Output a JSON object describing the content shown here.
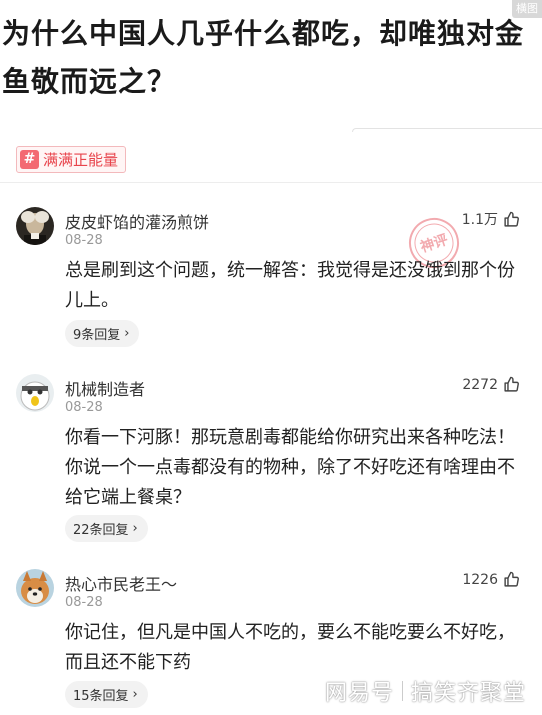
{
  "corner_label": "横图",
  "question": {
    "title": "为什么中国人几乎什么都吃，却唯独对金鱼敬而远之？"
  },
  "topic": {
    "label": "满满正能量",
    "icon": "hash-icon"
  },
  "stamp": {
    "text": "神评"
  },
  "comments": [
    {
      "username": "皮皮虾馅的灌汤煎饼",
      "date": "08-28",
      "likes": "1.1万",
      "text": "总是刷到这个问题，统一解答：我觉得是还没饿到那个份儿上。",
      "replies": "9条回复"
    },
    {
      "username": "机械制造者",
      "date": "08-28",
      "likes": "2272",
      "text": "你看一下河豚！那玩意剧毒都能给你研究出来各种吃法！你说一个一点毒都没有的物种，除了不好吃还有啥理由不给它端上餐桌？",
      "replies": "22条回复"
    },
    {
      "username": "热心市民老王～",
      "date": "08-28",
      "likes": "1226",
      "text": "你记住，但凡是中国人不吃的，要么不能吃要么不好吃，而且还不能下药",
      "replies": "15条回复"
    }
  ],
  "watermark": {
    "source": "网易号",
    "author": "搞笑齐聚堂"
  },
  "colors": {
    "tag_accent": "#e8444c",
    "tag_icon_bg": "#f36a72",
    "stamp": "#e9666e"
  }
}
